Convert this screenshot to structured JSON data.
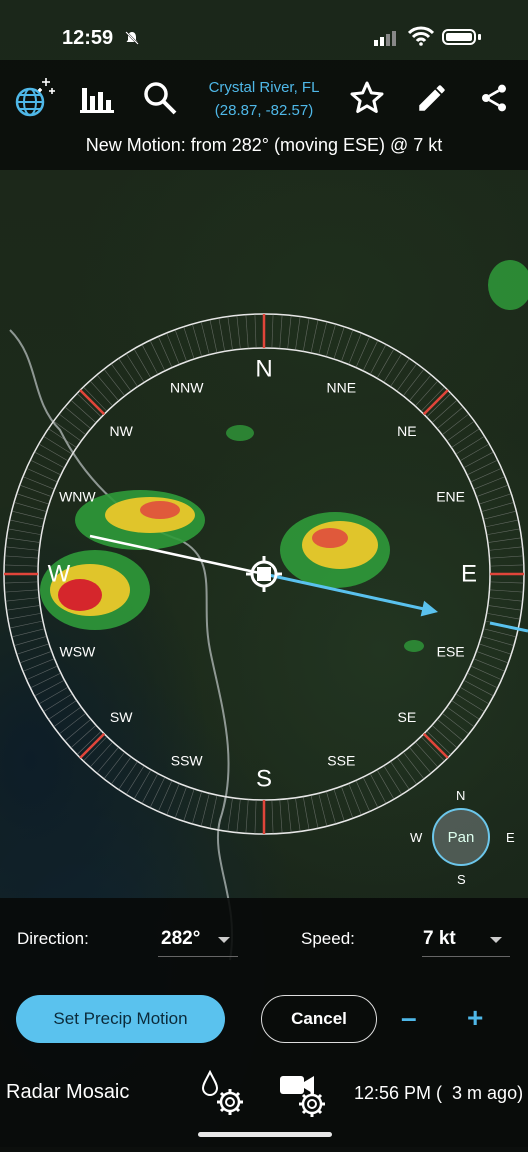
{
  "status": {
    "time": "12:59"
  },
  "toolbar": {
    "icons": [
      "globe-icon",
      "bar-chart-icon",
      "search-icon",
      "star-icon",
      "pencil-icon",
      "share-icon"
    ],
    "location_name": "Crystal River, FL",
    "location_coords": "(28.87, -82.57)"
  },
  "motion_text": "New Motion: from 282° (moving ESE) @ 7 kt",
  "compass": {
    "labels": [
      "N",
      "NNE",
      "NE",
      "ENE",
      "E",
      "ESE",
      "SE",
      "SSE",
      "S",
      "SSW",
      "SW",
      "WSW",
      "W",
      "WNW",
      "NW",
      "NNW"
    ],
    "from_direction_deg": 282
  },
  "pan": {
    "label": "Pan",
    "n": "N",
    "s": "S",
    "w": "W",
    "e": "E"
  },
  "controls": {
    "direction_label": "Direction:",
    "direction_value": "282°",
    "speed_label": "Speed:",
    "speed_value": "7 kt",
    "set_button": "Set Precip Motion",
    "cancel_button": "Cancel",
    "minus": "–",
    "plus": "+"
  },
  "bottom": {
    "title": "Radar Mosaic",
    "timestamp": "12:56 PM (  3 m ago)"
  },
  "colors": {
    "accent": "#5ac2ee",
    "arrow": "#5ac2ee",
    "tick_red": "#e0453a"
  }
}
